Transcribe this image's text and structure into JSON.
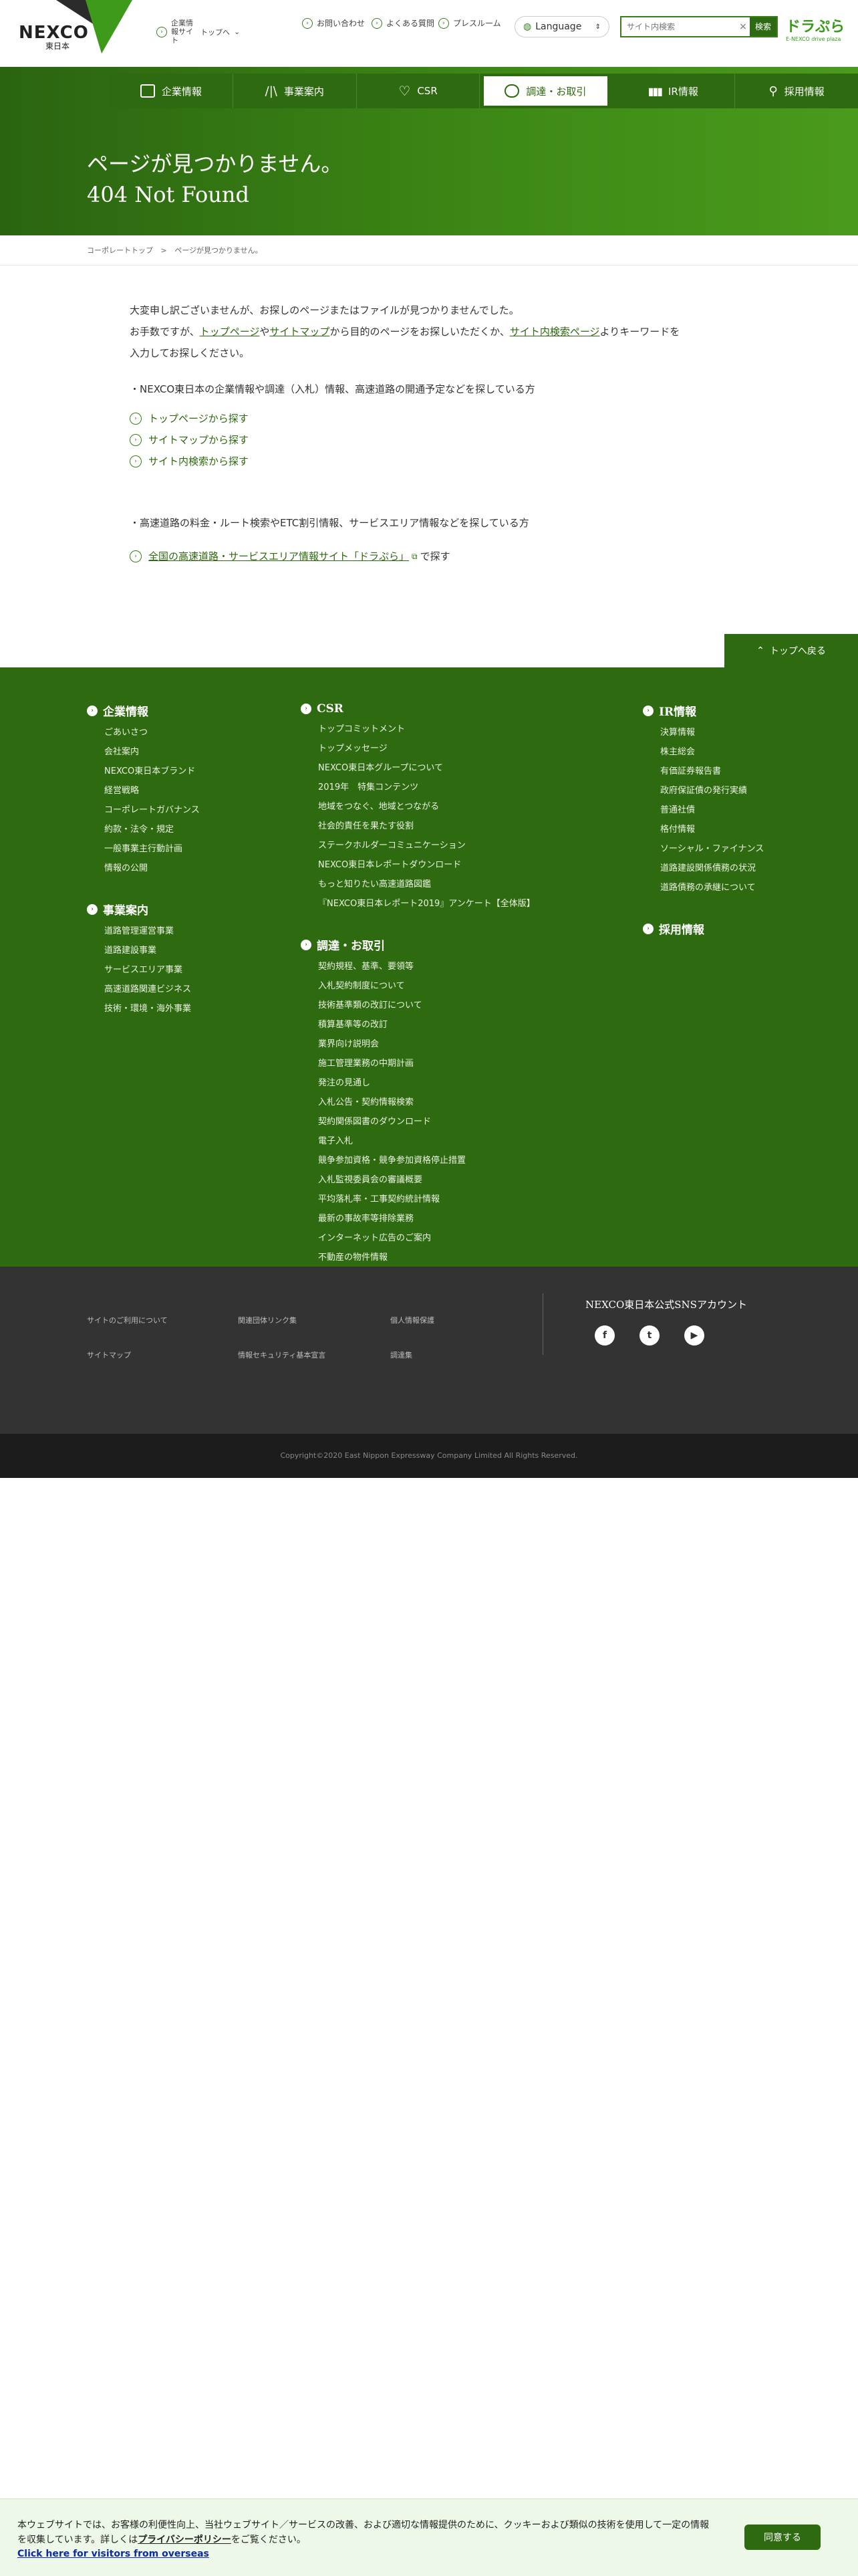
{
  "header": {
    "logo_text": "NEXCO",
    "logo_sub": "東日本",
    "corporate_site_label": "企業情報サイト",
    "corporate_site_suffix": "トップへ",
    "util_links": [
      "お問い合わせ",
      "よくある質問",
      "プレスルーム"
    ],
    "language_label": "Language",
    "search_placeholder": "サイト内検索",
    "search_button": "検索",
    "dorapura_title": "ドラぷら",
    "dorapura_sub": "E-NEXCO drive plaza"
  },
  "nav": {
    "items": [
      {
        "label": "企業情報",
        "icon": "building-icon"
      },
      {
        "label": "事業案内",
        "icon": "road-icon"
      },
      {
        "label": "CSR",
        "icon": "heart-icon"
      },
      {
        "label": "調達・お取引",
        "icon": "handshake-icon"
      },
      {
        "label": "IR情報",
        "icon": "chart-icon"
      },
      {
        "label": "採用情報",
        "icon": "person-icon"
      }
    ]
  },
  "hero": {
    "title_ja": "ページが見つかりません。",
    "title_en": "404 Not Found"
  },
  "breadcrumb": {
    "home": "コーポレートトップ",
    "sep": ">",
    "current": "ページが見つかりません。"
  },
  "content": {
    "line1": "大変申し訳ございませんが、お探しのページまたはファイルが見つかりませんでした。",
    "line2_pre": "お手数ですが、",
    "link_top": "トップページ",
    "line2_mid1": "や",
    "link_sitemap": "サイトマップ",
    "line2_mid2": "から目的のページをお探しいただくか、",
    "link_search": "サイト内検索ページ",
    "line2_post": "よりキーワードを",
    "line3": "入力してお探しください。",
    "section1_title": "・NEXCO東日本の企業情報や調達（入札）情報、高速道路の開通予定などを探している方",
    "section1_links": [
      "トップページから探す",
      "サイトマップから探す",
      "サイト内検索から探す"
    ],
    "section2_title": "・高速道路の料金・ルート検索やETC割引情報、サービスエリア情報などを探している方",
    "section2_link": "全国の高速道路・サービスエリア情報サイト「ドラぷら」",
    "section2_suffix": "で探す"
  },
  "to_top": "トップへ戻る",
  "footer": {
    "col1": [
      {
        "title": "企業情報",
        "items": [
          "ごあいさつ",
          "会社案内",
          "NEXCO東日本ブランド",
          "経営戦略",
          "コーポレートガバナンス",
          "約款・法令・規定",
          "一般事業主行動計画",
          "情報の公開"
        ]
      },
      {
        "title": "事業案内",
        "items": [
          "道路管理運営事業",
          "道路建設事業",
          "サービスエリア事業",
          "高速道路関連ビジネス",
          "技術・環境・海外事業"
        ]
      }
    ],
    "col2": [
      {
        "title": "CSR",
        "items": [
          "トップコミットメント",
          "トップメッセージ",
          "NEXCO東日本グループについて",
          "2019年　特集コンテンツ",
          "地域をつなぐ、地域とつながる",
          "社会的責任を果たす役割",
          "ステークホルダーコミュニケーション",
          "NEXCO東日本レポートダウンロード",
          "もっと知りたい高速道路図鑑",
          "『NEXCO東日本レポート2019』アンケート【全体版】"
        ]
      },
      {
        "title": "調達・お取引",
        "items": [
          "契約規程、基準、要領等",
          "入札契約制度について",
          "技術基準類の改訂について",
          "積算基準等の改訂",
          "業界向け説明会",
          "施工管理業務の中期計画",
          "発注の見通し",
          "入札公告・契約情報検索",
          "契約関係図書のダウンロード",
          "電子入札",
          "競争参加資格・競争参加資格停止措置",
          "入札監視委員会の審議概要",
          "平均落札率・工事契約統計情報",
          "最新の事故率等排除業務",
          "インターネット広告のご案内",
          "不動産の物件情報"
        ]
      }
    ],
    "col3": [
      {
        "title": "IR情報",
        "items": [
          "決算情報",
          "株主総会",
          "有価証券報告書",
          "政府保証債の発行実績",
          "普通社債",
          "格付情報",
          "ソーシャル・ファイナンス",
          "道路建設関係債務の状況",
          "道路債務の承継について"
        ]
      },
      {
        "title": "採用情報",
        "items": []
      }
    ],
    "bottom_links": [
      "サイトのご利用について",
      "関連団体リンク集",
      "個人情報保護",
      "サイトマップ",
      "情報セキュリティ基本宣言",
      "調達集"
    ],
    "sns_title": "NEXCO東日本公式SNSアカウント",
    "sns": [
      {
        "name": "facebook-icon",
        "glyph": "f"
      },
      {
        "name": "twitter-icon",
        "glyph": "t"
      },
      {
        "name": "youtube-icon",
        "glyph": "▶"
      }
    ],
    "copyright": "Copyright©2020 East Nippon Expressway Company Limited All Rights Reserved."
  },
  "cookie": {
    "text_pre": "本ウェブサイトでは、お客様の利便性向上、当社ウェブサイト／サービスの改善、および適切な情報提供のために、クッキーおよび類似の技術を使用して一定の情報を収集しています。詳しくは",
    "policy_link": "プライバシーポリシー",
    "text_post": "をご覧ください。",
    "overseas_link": "Click here for visitors from overseas",
    "agree_button": "同意する"
  },
  "colors": {
    "brand_green": "#2e6a0f",
    "dark_footer": "#333333",
    "copyright_bar": "#1c1c1c"
  }
}
